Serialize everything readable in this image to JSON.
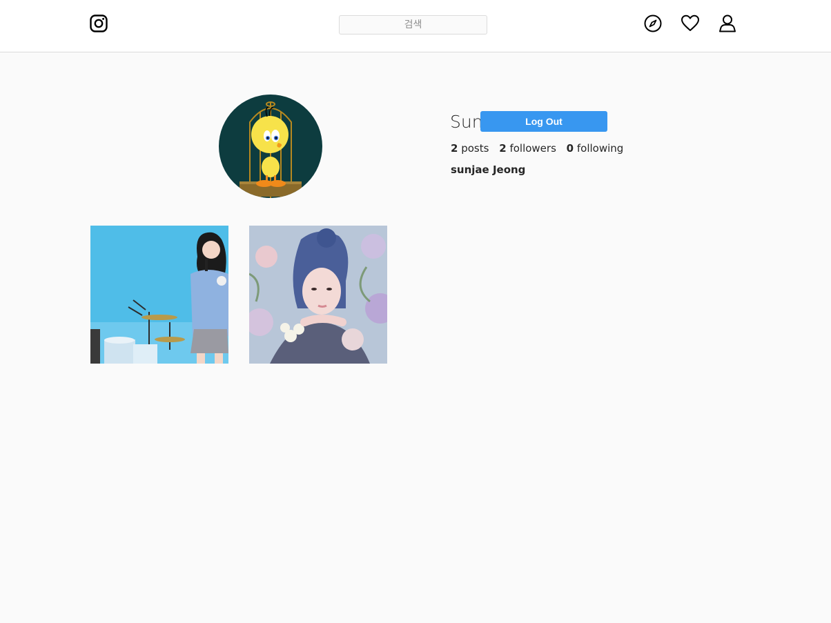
{
  "header": {
    "search": {
      "placeholder": "검색",
      "value": ""
    },
    "icons": [
      "instagram-logo-icon",
      "compass-icon",
      "heart-icon",
      "user-icon"
    ]
  },
  "profile": {
    "username": "Sun",
    "logout_label": "Log Out",
    "stats": {
      "posts_count": "2",
      "posts_label": "posts",
      "followers_count": "2",
      "followers_label": "followers",
      "following_count": "0",
      "following_label": "following"
    },
    "full_name": "sunjae Jeong"
  },
  "posts": [
    {
      "description": "photo-concert-stage"
    },
    {
      "description": "photo-portrait-flowers"
    }
  ],
  "colors": {
    "accent": "#3897f0",
    "background": "#fafafa",
    "border": "#dbdbdb",
    "text": "#262626"
  }
}
